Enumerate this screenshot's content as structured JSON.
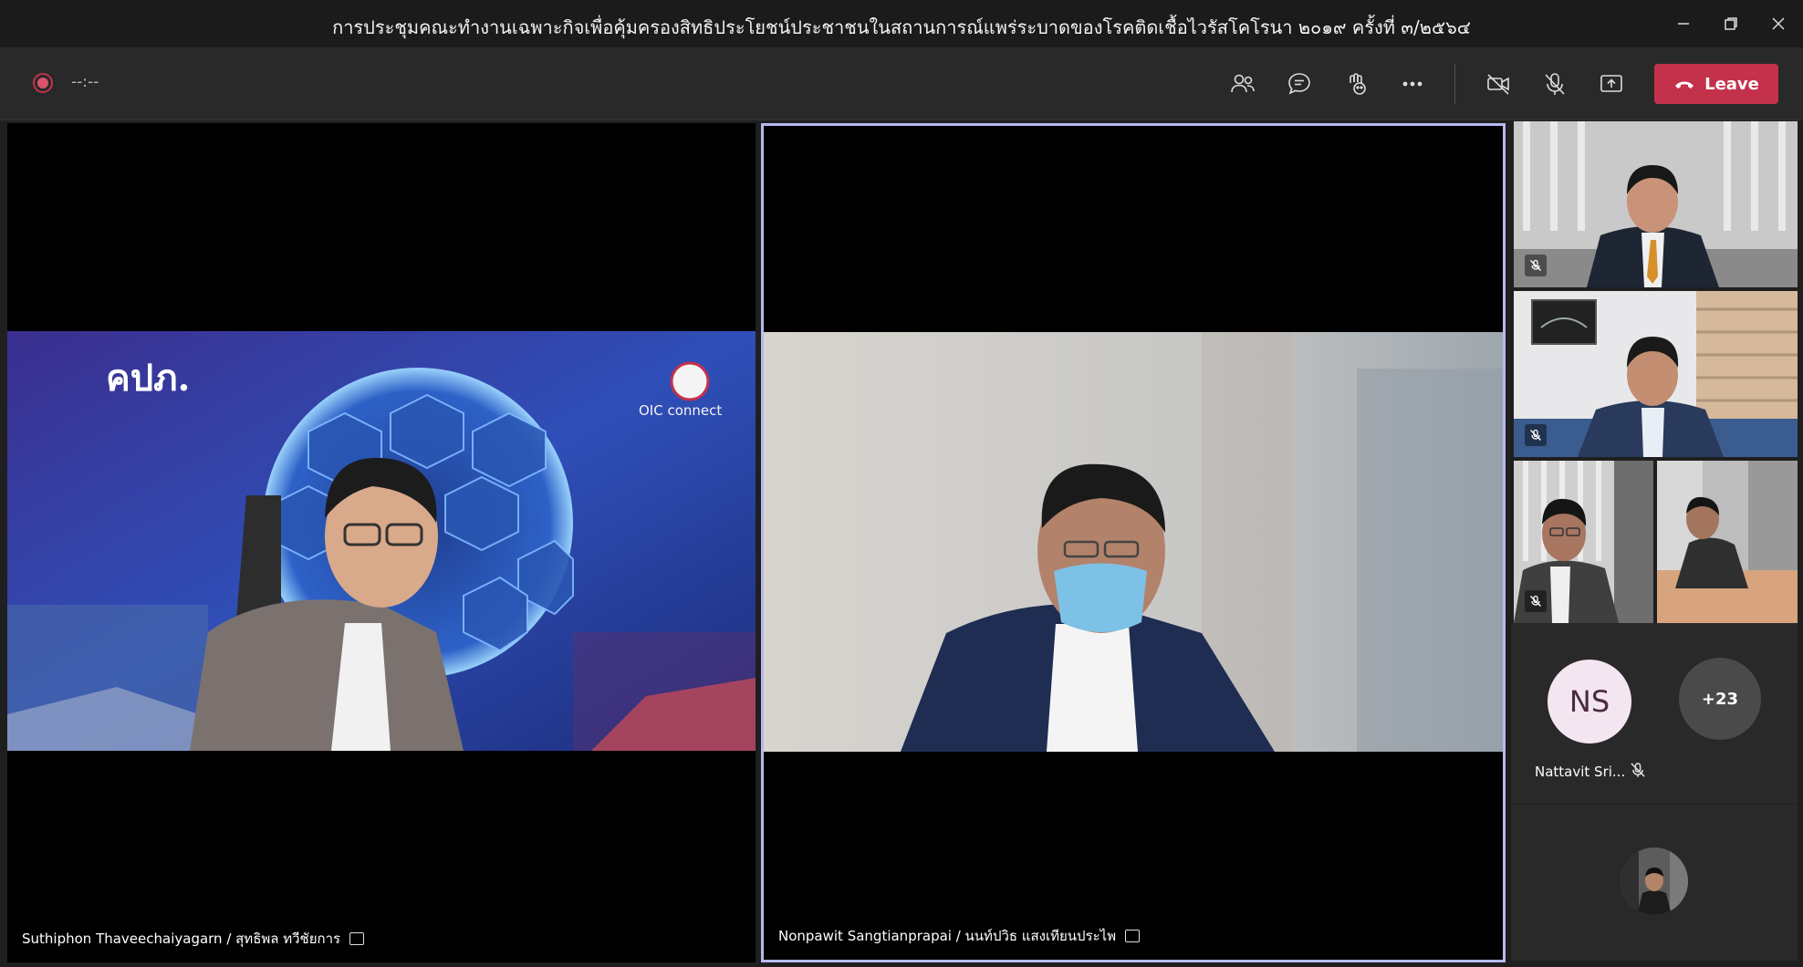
{
  "window": {
    "title": "การประชุมคณะทำงานเฉพาะกิจเพื่อคุ้มครองสิทธิประโยชน์ประชาชนในสถานการณ์แพร่ระบาดของโรคติดเชื้อไวรัสโคโรนา ๒๐๑๙ ครั้งที่ ๓/๒๕๖๔",
    "controls": [
      "minimize",
      "maximize",
      "close"
    ]
  },
  "toolbar": {
    "recording_status": "recording-icon",
    "timer": "--:--",
    "icons": [
      "participants-icon",
      "chat-icon",
      "reactions-icon",
      "more-icon",
      "camera-off-icon",
      "mic-off-icon",
      "share-icon"
    ],
    "leave_label": "Leave",
    "leave_color": "#c4314b"
  },
  "stage": {
    "tiles": [
      {
        "caption": "Suthiphon Thaveechaiyagarn / สุทธิพล ทวีชัยการ",
        "background_logo": "คปภ.",
        "brand_logo": "OIC connect",
        "highlighted": false
      },
      {
        "caption": "Nonpawit Sangtianprapai / นนท์ปวิธ แสงเทียนประไพ",
        "highlighted": true,
        "highlight_color": "#b7b9f0"
      }
    ]
  },
  "rail": {
    "participants": [
      {
        "type": "video",
        "muted": true
      },
      {
        "type": "video",
        "muted": true
      },
      {
        "type": "video",
        "muted": true
      },
      {
        "type": "video",
        "muted": false
      }
    ],
    "avatar": {
      "initials": "NS",
      "name": "Nattavit Sri...",
      "muted": true
    },
    "overflow_count": "+23",
    "self_view": "self-view-avatar"
  }
}
